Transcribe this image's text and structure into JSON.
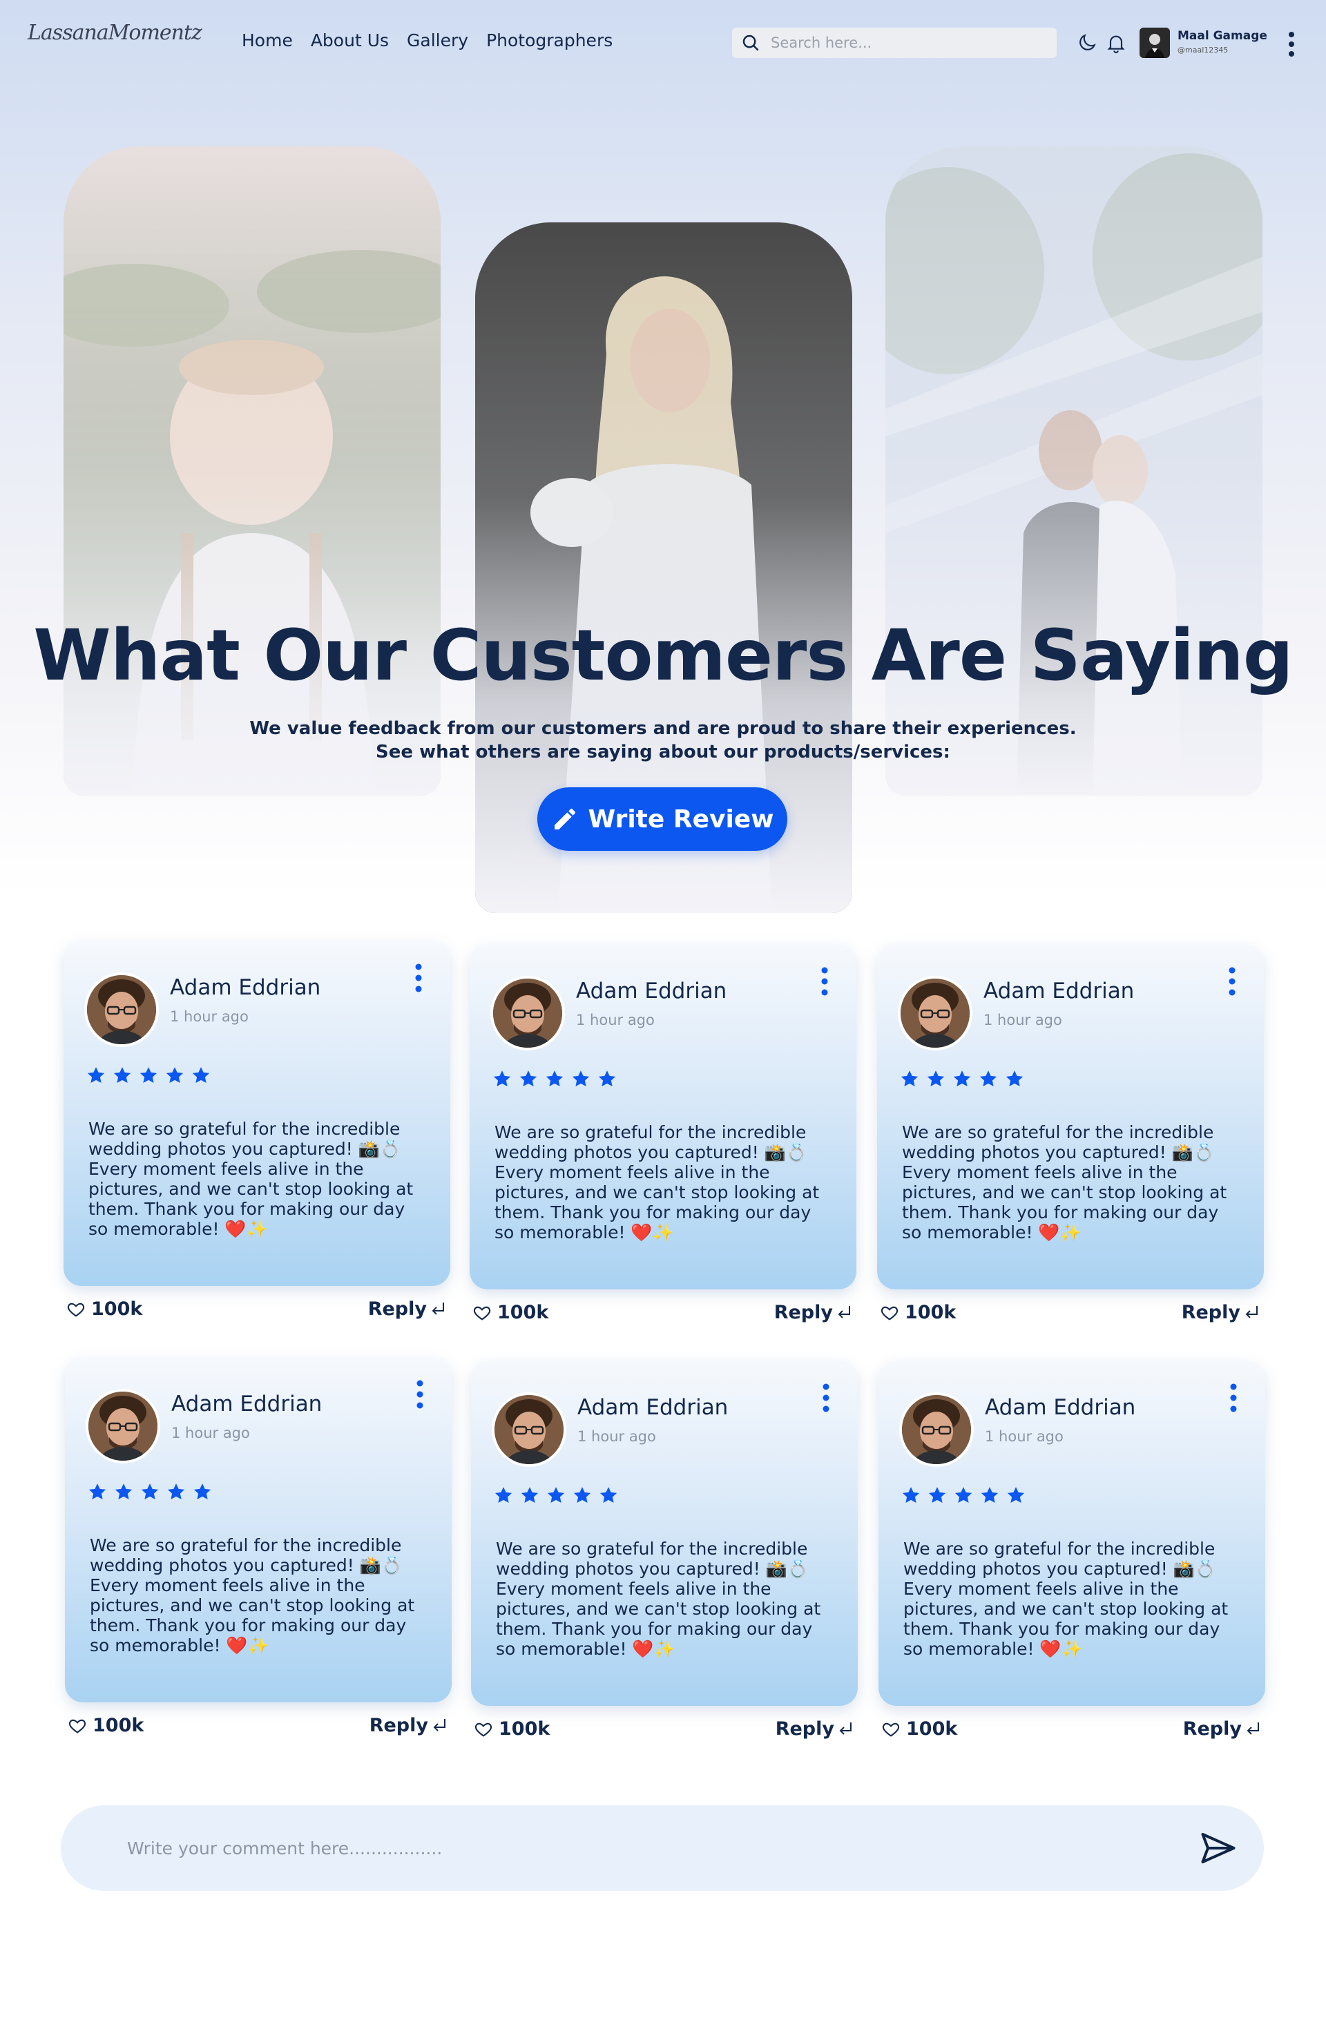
{
  "nav": {
    "logo": "LassanaMomentz",
    "links": [
      "Home",
      "About Us",
      "Gallery",
      "Photographers"
    ],
    "search_placeholder": "Search here...",
    "user_name": "Maal Gamage",
    "user_handle": "@maal12345",
    "icons": [
      "search-icon",
      "moon-icon",
      "bell-icon",
      "more-vertical-icon"
    ]
  },
  "hero": {
    "title": "What Our Customers Are Saying",
    "subtitle_line1": "We value feedback from our customers and are proud to share their experiences.",
    "subtitle_line2": "See what others are saying about our products/services:",
    "button_label": "Write Review",
    "photos": [
      "baby-portrait-photo",
      "bride-portrait-photo",
      "wedding-couple-photo"
    ]
  },
  "reviews": [
    {
      "name": "Adam Eddrian",
      "time": "1 hour ago",
      "rating": 5,
      "text": "We are so grateful for the incredible wedding photos you captured! 📸💍 Every moment feels alive in the pictures, and we can't stop looking at them. Thank you for making our day so memorable! ❤️✨",
      "likes": "100k",
      "reply": "Reply"
    },
    {
      "name": "Adam Eddrian",
      "time": "1 hour ago",
      "rating": 5,
      "text": "We are so grateful for the incredible wedding photos you captured! 📸💍 Every moment feels alive in the pictures, and we can't stop looking at them. Thank you for making our day so memorable! ❤️✨",
      "likes": "100k",
      "reply": "Reply"
    },
    {
      "name": "Adam Eddrian",
      "time": "1 hour ago",
      "rating": 5,
      "text": "We are so grateful for the incredible wedding photos you captured! 📸💍 Every moment feels alive in the pictures, and we can't stop looking at them. Thank you for making our day so memorable! ❤️✨",
      "likes": "100k",
      "reply": "Reply"
    },
    {
      "name": "Adam Eddrian",
      "time": "1 hour ago",
      "rating": 5,
      "text": "We are so grateful for the incredible wedding photos you captured! 📸💍 Every moment feels alive in the pictures, and we can't stop looking at them. Thank you for making our day so memorable! ❤️✨",
      "likes": "100k",
      "reply": "Reply"
    },
    {
      "name": "Adam Eddrian",
      "time": "1 hour ago",
      "rating": 5,
      "text": "We are so grateful for the incredible wedding photos you captured! 📸💍 Every moment feels alive in the pictures, and we can't stop looking at them. Thank you for making our day so memorable! ❤️✨",
      "likes": "100k",
      "reply": "Reply"
    },
    {
      "name": "Adam Eddrian",
      "time": "1 hour ago",
      "rating": 5,
      "text": "We are so grateful for the incredible wedding photos you captured! 📸💍 Every moment feels alive in the pictures, and we can't stop looking at them. Thank you for making our day so memorable! ❤️✨",
      "likes": "100k",
      "reply": "Reply"
    }
  ],
  "comment": {
    "placeholder": "Write your comment here.................",
    "send_icon": "send-icon"
  },
  "colors": {
    "primary": "#0b57f0",
    "text_dark": "#14284b",
    "star": "#0b57f0",
    "card_gradient_bottom": "#a9d2f2"
  }
}
